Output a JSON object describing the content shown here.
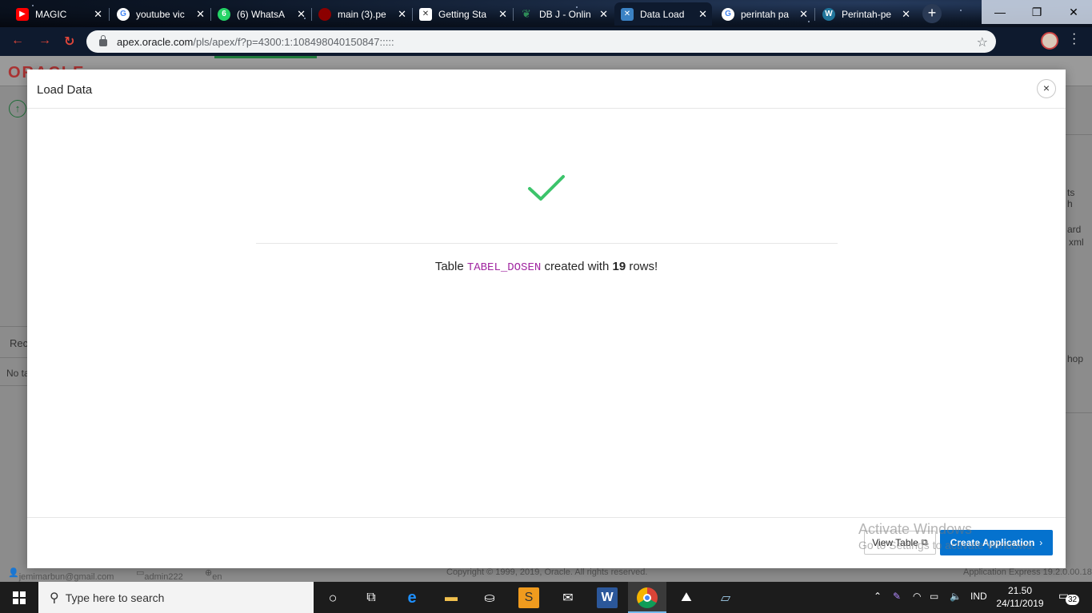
{
  "browser": {
    "tabs": [
      {
        "label": "MAGIC",
        "icon": "youtube-icon",
        "color": "#ff0000"
      },
      {
        "label": "youtube vic",
        "icon": "google-icon",
        "color": "#4285f4"
      },
      {
        "label": "(6) WhatsA",
        "icon": "whatsapp-icon",
        "color": "#25d366"
      },
      {
        "label": "main (3).pe",
        "icon": "pdf-icon",
        "color": "#c00000"
      },
      {
        "label": "Getting Sta",
        "icon": "x-app-icon",
        "color": "#ffffff"
      },
      {
        "label": "DB J - Onlin",
        "icon": "leaf-icon",
        "color": "#2e8b57"
      },
      {
        "label": "Data Load",
        "icon": "apex-icon",
        "color": "#3b82c4"
      },
      {
        "label": "perintah pa",
        "icon": "google-icon",
        "color": "#4285f4"
      },
      {
        "label": "Perintah-pe",
        "icon": "wordpress-icon",
        "color": "#21759b"
      }
    ],
    "new_tab": "+",
    "url_host": "apex.oracle.com",
    "url_path": "/pls/apex/f?p=4300:1:108498040150847:::::"
  },
  "background_page": {
    "logo": "ORACLE",
    "side_label_1": "Rec",
    "side_label_2": "No ta",
    "right_text_1": "ts",
    "right_text_2": "h",
    "right_text_3": "ard",
    "right_text_4": "xml",
    "right_text_5": "hop",
    "footer_email": "jemimarbun@gmail.com",
    "footer_workspace": "admin222",
    "footer_lang": "en",
    "footer_copyright": "Copyright © 1999, 2019, Oracle. All rights reserved.",
    "footer_version": "Application Express 19.2.0.00.18"
  },
  "dialog": {
    "title": "Load Data",
    "close_glyph": "×",
    "message_prefix": "Table",
    "table_name": "TABEL_DOSEN",
    "message_middle": "created with",
    "row_count": "19",
    "message_suffix": "rows!",
    "view_table_label": "View Table",
    "create_app_label": "Create Application",
    "success_color": "#3cc46b",
    "primary_color": "#0572ce"
  },
  "watermark": {
    "line1": "Activate Windows",
    "line2": "Go to Settings to activate Windows."
  },
  "taskbar": {
    "search_placeholder": "Type here to search",
    "language": "IND",
    "time": "21.50",
    "date": "24/11/2019",
    "notification_count": "32"
  }
}
